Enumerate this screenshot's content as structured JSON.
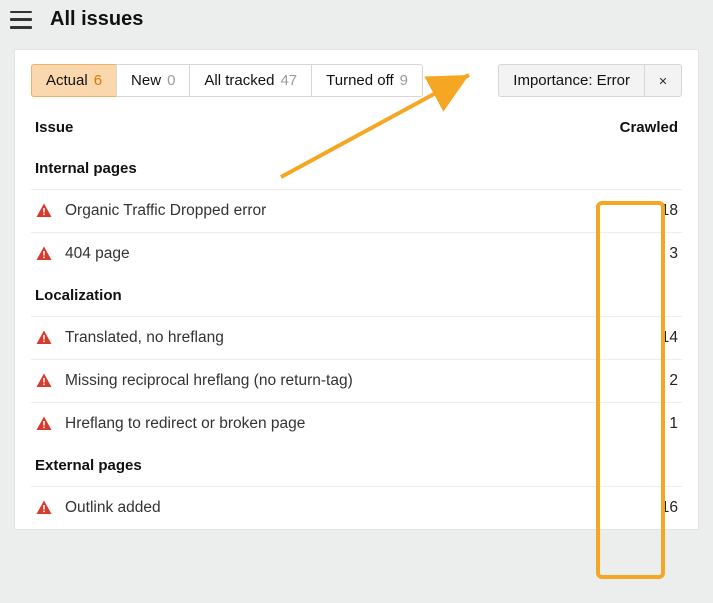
{
  "header": {
    "title": "All issues"
  },
  "filters": {
    "tabs": [
      {
        "label": "Actual",
        "count": "6"
      },
      {
        "label": "New",
        "count": "0"
      },
      {
        "label": "All tracked",
        "count": "47"
      },
      {
        "label": "Turned off",
        "count": "9"
      }
    ],
    "importance_chip": "Importance: Error"
  },
  "columns": {
    "issue": "Issue",
    "crawled": "Crawled"
  },
  "sections": [
    {
      "title": "Internal pages",
      "rows": [
        {
          "label": "Organic Traffic Dropped error",
          "value": "18"
        },
        {
          "label": "404 page",
          "value": "3"
        }
      ]
    },
    {
      "title": "Localization",
      "rows": [
        {
          "label": "Translated, no hreflang",
          "value": "14"
        },
        {
          "label": "Missing reciprocal hreflang (no return-tag)",
          "value": "2"
        },
        {
          "label": "Hreflang to redirect or broken page",
          "value": "1"
        }
      ]
    },
    {
      "title": "External pages",
      "rows": [
        {
          "label": "Outlink added",
          "value": "16"
        }
      ]
    }
  ]
}
